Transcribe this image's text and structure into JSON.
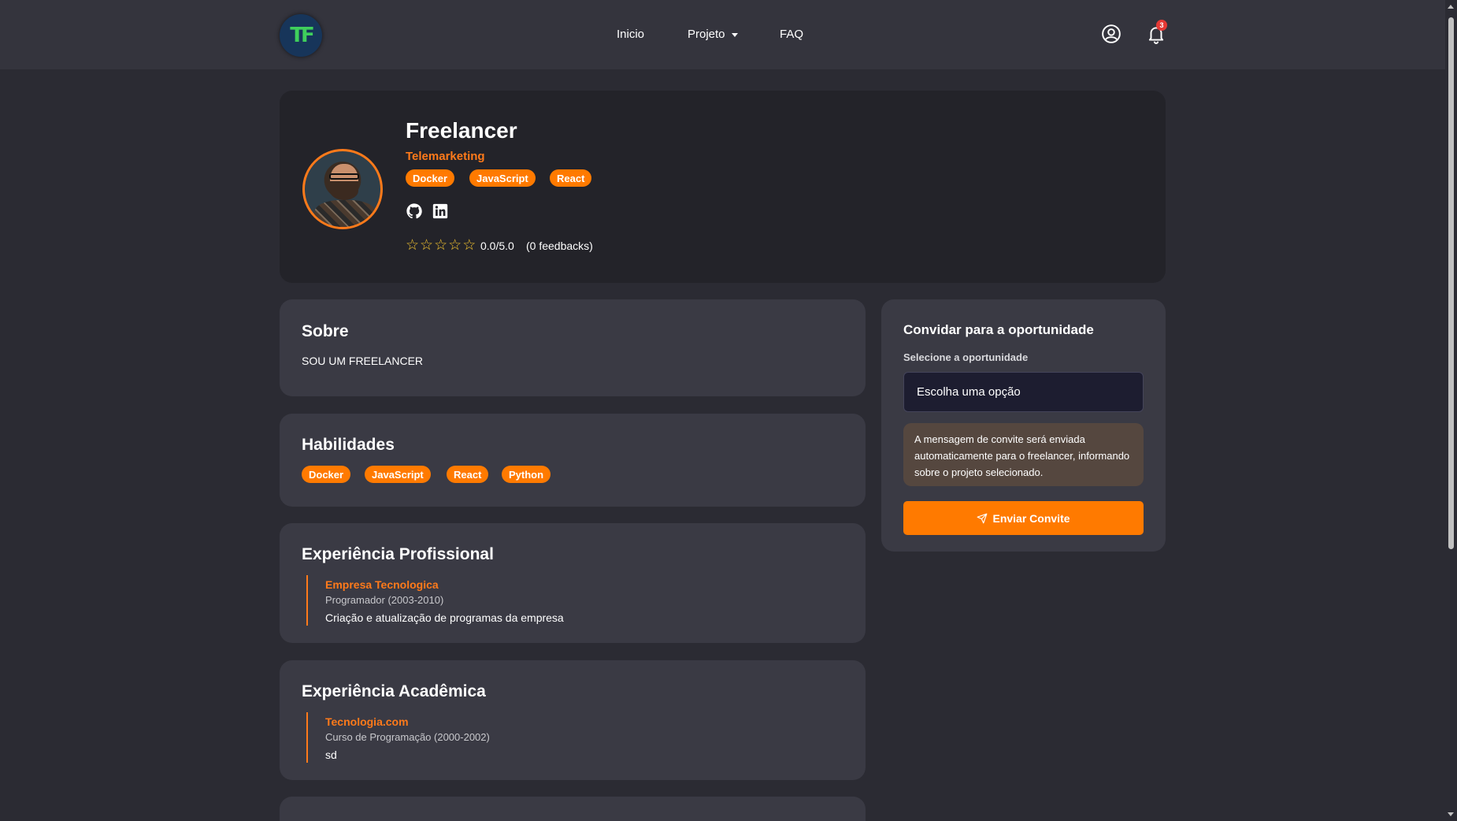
{
  "nav": {
    "logo_text": "TF",
    "links": [
      "Inicio",
      "Projeto",
      "FAQ"
    ],
    "notification_count": "3"
  },
  "profile": {
    "name": "Freelancer",
    "role": "Telemarketing",
    "tags": [
      "Docker",
      "JavaScript",
      "React"
    ],
    "rating": "0.0/5.0",
    "feedbacks": "(0 feedbacks)",
    "stars_filled": 0,
    "stars_total": 5
  },
  "about": {
    "title": "Sobre",
    "text": "SOU UM FREELANCER"
  },
  "skills": {
    "title": "Habilidades",
    "items": [
      "Docker",
      "JavaScript",
      "React",
      "Python"
    ]
  },
  "professional": {
    "title": "Experiência Profissional",
    "company": "Empresa Tecnologica",
    "meta": "Programador (2003-2010)",
    "description": "Criação e atualização de programas da empresa"
  },
  "academic": {
    "title": "Experiência Acadêmica",
    "institution": "Tecnologia.com",
    "meta": "Curso de Programação (2000-2002)",
    "description": "sd"
  },
  "invite": {
    "title": "Convidar para a oportunidade",
    "label": "Selecione a oportunidade",
    "select_value": "Escolha uma opção",
    "info": "A mensagem de convite será enviada automaticamente para o freelancer, informando sobre o projeto selecionado.",
    "button_label": "Enviar Convite"
  },
  "colors": {
    "accent": "#ff7a00",
    "background": "#2b2b33",
    "card": "#3a3a44",
    "star": "#f2c230"
  }
}
